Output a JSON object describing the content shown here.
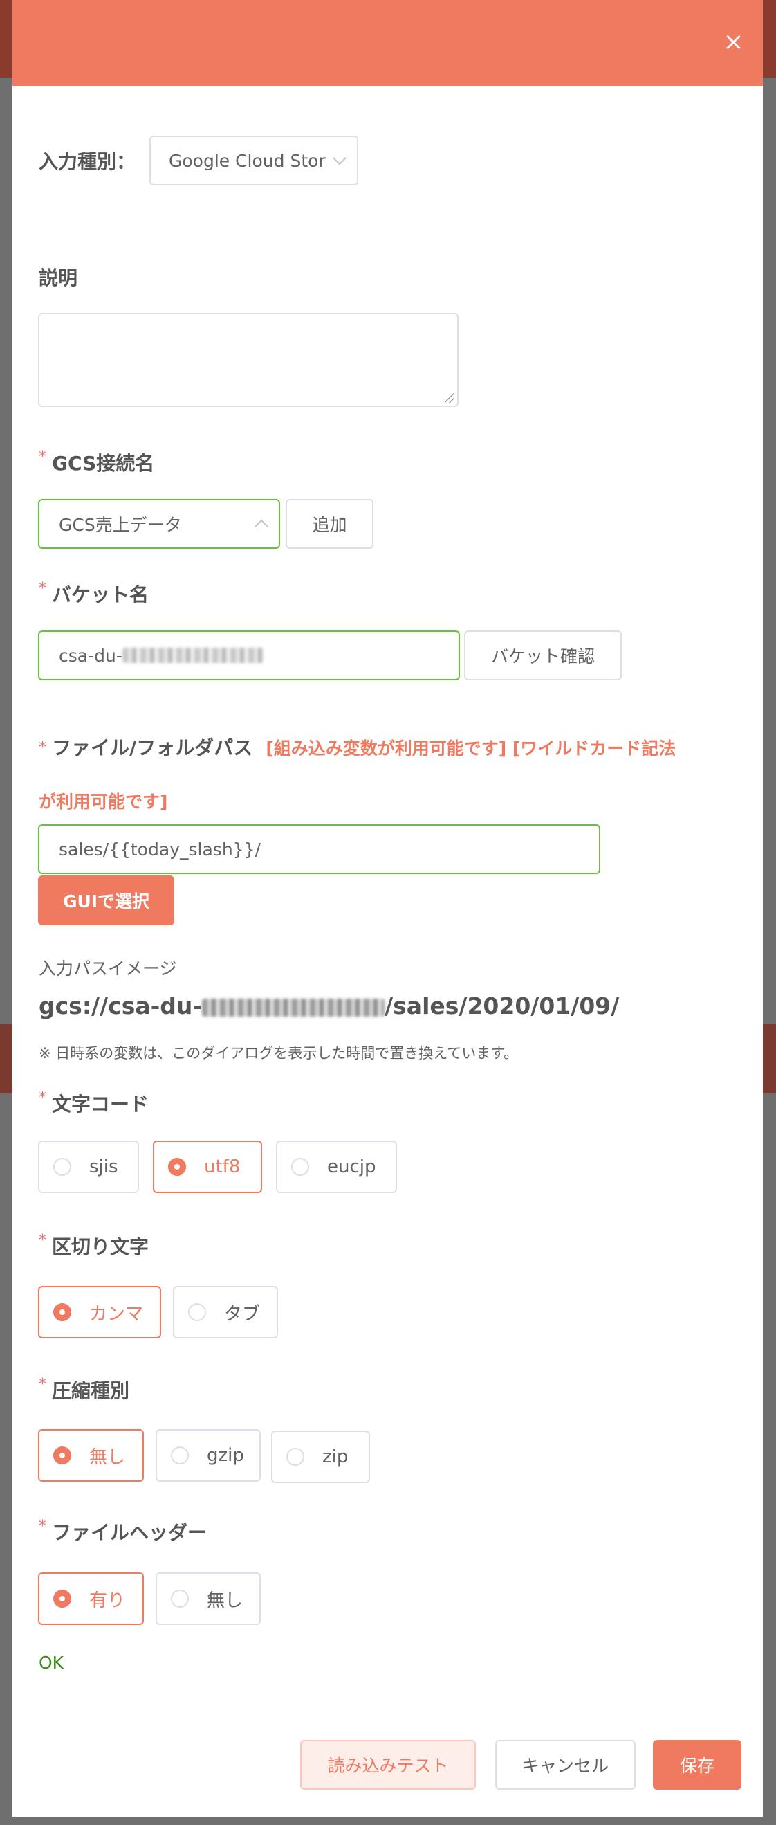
{
  "dialog": {
    "input_type": {
      "label": "入力種別：",
      "value": "Google Cloud Stora"
    },
    "description": {
      "label": "説明",
      "value": ""
    },
    "gcs_connection": {
      "label": "GCS接続名",
      "value": "GCS売上データ",
      "add_button": "追加"
    },
    "bucket": {
      "label": "バケット名",
      "value_prefix": "csa-du-",
      "check_button": "バケット確認"
    },
    "file_path": {
      "label": "ファイル/フォルダパス",
      "note_line1": "[組み込み変数が利用可能です] [ワイルドカード記法",
      "note_line2": "が利用可能です]",
      "value": "sales/{{today_slash}}/",
      "gui_button": "GUIで選択"
    },
    "path_image": {
      "label": "入力パスイメージ",
      "prefix": "gcs://csa-du-",
      "suffix": "/sales/2020/01/09/",
      "note": "※ 日時系の変数は、このダイアログを表示した時間で置き換えています。"
    },
    "encoding": {
      "label": "文字コード",
      "options": [
        "sjis",
        "utf8",
        "eucjp"
      ],
      "selected": "utf8"
    },
    "delimiter": {
      "label": "区切り文字",
      "options": [
        "カンマ",
        "タブ"
      ],
      "selected": "カンマ"
    },
    "compression": {
      "label": "圧縮種別",
      "options": [
        "無し",
        "gzip",
        "zip"
      ],
      "selected": "無し"
    },
    "header": {
      "label": "ファイルヘッダー",
      "options": [
        "有り",
        "無し"
      ],
      "selected": "有り"
    },
    "status": "OK",
    "footer": {
      "test_button": "読み込みテスト",
      "cancel_button": "キャンセル",
      "save_button": "保存"
    }
  },
  "colors": {
    "accent": "#f07a60",
    "success": "#67c23a",
    "required": "#f56c6c"
  }
}
